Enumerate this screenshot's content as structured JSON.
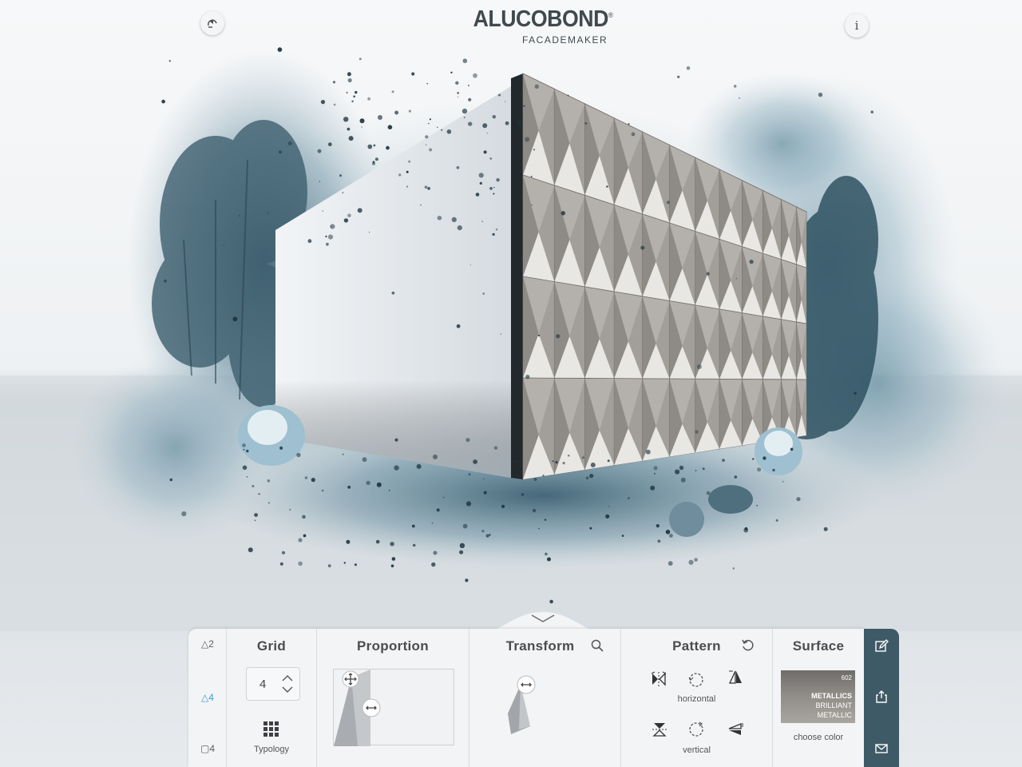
{
  "header": {
    "logo_main": "ALUCOBOND",
    "logo_reg": "®",
    "logo_sub": "FACADEMAKER",
    "info_label": "i"
  },
  "panel": {
    "view_options": [
      {
        "label": "△2",
        "active": false
      },
      {
        "label": "△4",
        "active": true
      },
      {
        "label": "▢4",
        "active": false
      }
    ],
    "grid": {
      "title": "Grid",
      "value": "4",
      "typology_label": "Typology"
    },
    "proportion": {
      "title": "Proportion"
    },
    "transform": {
      "title": "Transform"
    },
    "pattern": {
      "title": "Pattern",
      "horizontal_label": "horizontal",
      "vertical_label": "vertical"
    },
    "surface": {
      "title": "Surface",
      "swatch_code": "602",
      "swatch_line1": "METALLICS",
      "swatch_line2": "BRILLIANT",
      "swatch_line3": "METALLIC",
      "choose_label": "choose color"
    }
  },
  "colors": {
    "accent": "#3b9ed1",
    "rail": "#3e5a66",
    "panel": "#f3f4f5",
    "watercolor": "#4f7b90"
  },
  "icons": [
    "home-icon",
    "info-icon",
    "chevron-down-icon",
    "chevron-up-icon",
    "grid-icon",
    "move-icon",
    "resize-horizontal-icon",
    "search-icon",
    "reset-icon",
    "flip-icon",
    "rotate-icon",
    "mirror-icon",
    "edit-icon",
    "share-icon",
    "mail-icon"
  ]
}
